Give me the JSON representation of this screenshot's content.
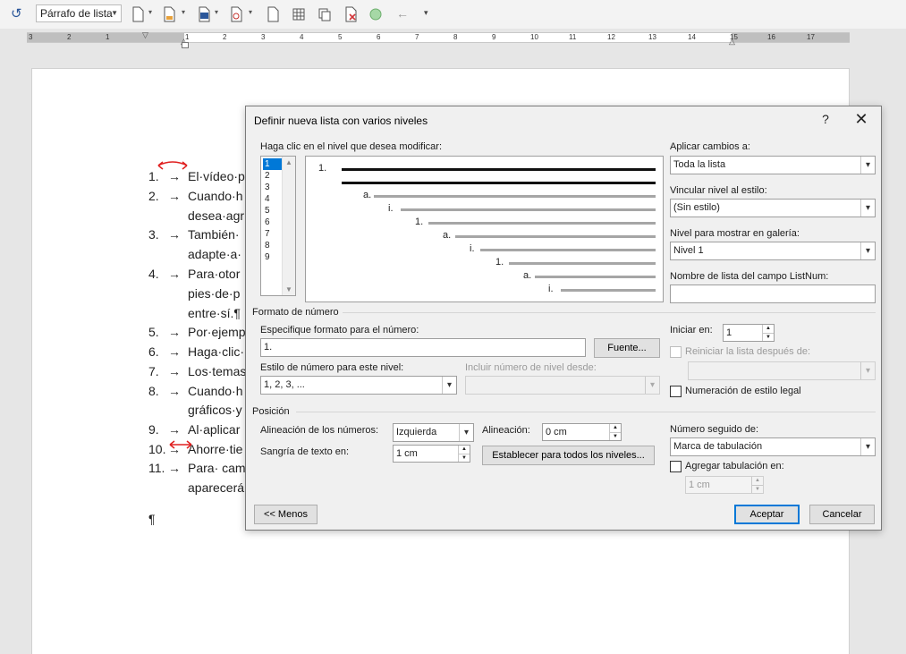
{
  "toolbar": {
    "style_value": "Párrafo de lista"
  },
  "ruler": {
    "numbers": [
      "3",
      "2",
      "1",
      "1",
      "2",
      "3",
      "4",
      "5",
      "6",
      "7",
      "8",
      "9",
      "10",
      "11",
      "12",
      "13",
      "14",
      "15",
      "16",
      "17"
    ]
  },
  "document": {
    "items": [
      {
        "num": "1.",
        "text": "El·vídeo·p"
      },
      {
        "num": "2.",
        "text": "Cuando·h"
      },
      {
        "num": "",
        "text": "desea·agr"
      },
      {
        "num": "3.",
        "text": "También·"
      },
      {
        "num": "",
        "text": "adapte·a·"
      },
      {
        "num": "4.",
        "text": "Para·otor"
      },
      {
        "num": "",
        "text": "pies·de·p"
      },
      {
        "num": "",
        "text": "entre·sí.¶"
      },
      {
        "num": "5.",
        "text": "Por·ejemp"
      },
      {
        "num": "6.",
        "text": "Haga·clic·"
      },
      {
        "num": "7.",
        "text": "Los·temas"
      },
      {
        "num": "8.",
        "text": "Cuando·h"
      },
      {
        "num": "",
        "text": "gráficos·y"
      },
      {
        "num": "9.",
        "text": "Al·aplicar"
      },
      {
        "num": "10.",
        "text": "Ahorre·tie"
      },
      {
        "num": "11.",
        "text": "Para· cam"
      },
      {
        "num": "",
        "text": "aparecerá"
      }
    ],
    "tab_arrow": "→",
    "pilcrow": "¶"
  },
  "dialog": {
    "title": "Definir nueva lista con varios niveles",
    "help": "?",
    "close": "✕",
    "level_prompt": "Haga clic en el nivel que desea modificar:",
    "levels": [
      "1",
      "2",
      "3",
      "4",
      "5",
      "6",
      "7",
      "8",
      "9"
    ],
    "preview_labels": [
      "1.",
      "a.",
      "i.",
      "1.",
      "a.",
      "i.",
      "1.",
      "a.",
      "i."
    ],
    "apply_label": "Aplicar cambios a:",
    "apply_value": "Toda la lista",
    "link_label": "Vincular nivel al estilo:",
    "link_value": "(Sin estilo)",
    "gallery_label": "Nivel para mostrar en galería:",
    "gallery_value": "Nivel 1",
    "listnum_label": "Nombre de lista del campo ListNum:",
    "listnum_value": "",
    "number_format_section": "Formato de número",
    "format_label": "Especifique formato para el número:",
    "format_value": "1.",
    "font_button": "Fuente...",
    "start_label": "Iniciar en:",
    "start_value": "1",
    "restart_label": "Reiniciar la lista después de:",
    "style_label": "Estilo de número para este nivel:",
    "style_value": "1, 2, 3, ...",
    "include_label": "Incluir número de nivel desde:",
    "legal_label": "Numeración de estilo legal",
    "position_section": "Posición",
    "align_label": "Alineación de los números:",
    "align_value": "Izquierda",
    "alignment_label": "Alineación:",
    "alignment_value": "0 cm",
    "indent_label": "Sangría de texto en:",
    "indent_value": "1 cm",
    "set_all_button": "Establecer para todos los niveles...",
    "followed_label": "Número seguido de:",
    "followed_value": "Marca de tabulación",
    "add_tab_label": "Agregar tabulación en:",
    "add_tab_value": "1 cm",
    "less_button": "<< Menos",
    "ok_button": "Aceptar",
    "cancel_button": "Cancelar"
  }
}
